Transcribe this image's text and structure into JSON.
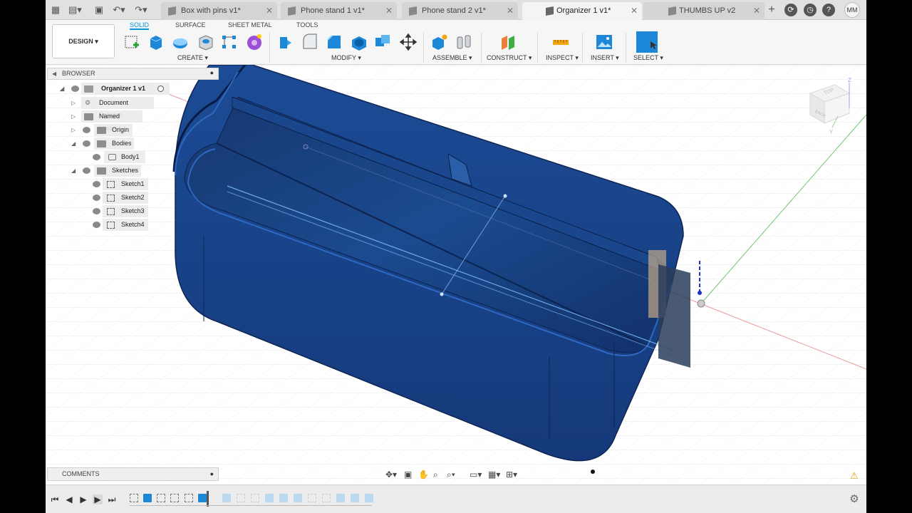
{
  "tabs": [
    {
      "label": "Box with pins v1*",
      "active": false
    },
    {
      "label": "Phone stand 1 v1*",
      "active": false
    },
    {
      "label": "Phone stand 2 v1*",
      "active": false
    },
    {
      "label": "Organizer 1 v1*",
      "active": true
    },
    {
      "label": "THUMBS UP v2",
      "active": false
    }
  ],
  "user_initials": "MM",
  "workspace": {
    "label": "DESIGN ▾"
  },
  "ws_tabs": [
    "SOLID",
    "SURFACE",
    "SHEET METAL",
    "TOOLS"
  ],
  "groups": {
    "create": "CREATE ▾",
    "modify": "MODIFY ▾",
    "assemble": "ASSEMBLE ▾",
    "construct": "CONSTRUCT ▾",
    "inspect": "INSPECT ▾",
    "insert": "INSERT ▾",
    "select": "SELECT ▾"
  },
  "browser": {
    "title": "BROWSER",
    "items": [
      {
        "label": "Organizer 1 v1"
      },
      {
        "label": "Document Settings"
      },
      {
        "label": "Named Views"
      },
      {
        "label": "Origin"
      },
      {
        "label": "Bodies"
      },
      {
        "label": "Body1"
      },
      {
        "label": "Sketches"
      },
      {
        "label": "Sketch1"
      },
      {
        "label": "Sketch2"
      },
      {
        "label": "Sketch3"
      },
      {
        "label": "Sketch4"
      }
    ]
  },
  "comments": {
    "title": "COMMENTS"
  },
  "viewcube": {
    "top": "TOP",
    "back": "BACK",
    "z": "Z",
    "y": "Y"
  },
  "colors": {
    "accent": "#0696d7",
    "body": "#1f4a8f",
    "body_dark": "#102a5a"
  }
}
